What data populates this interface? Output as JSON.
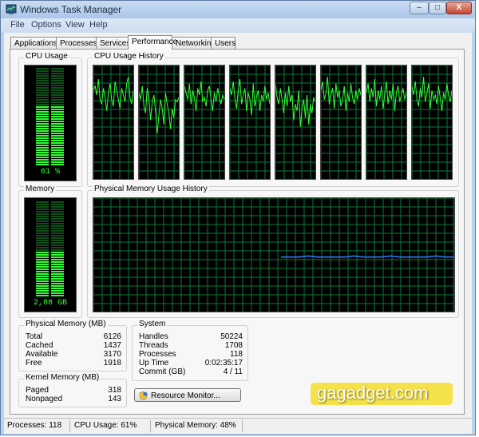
{
  "window": {
    "title": "Windows Task Manager",
    "controls": {
      "minimize": "–",
      "maximize": "□",
      "close": "X"
    }
  },
  "menu": [
    "File",
    "Options",
    "View",
    "Help"
  ],
  "tabs": [
    "Applications",
    "Processes",
    "Services",
    "Performance",
    "Networking",
    "Users"
  ],
  "active_tab": "Performance",
  "cpu": {
    "usage_label": "CPU Usage",
    "usage_text": "61 %",
    "usage_percent": 61,
    "history_label": "CPU Usage History",
    "core_count": 8,
    "core_histories": [
      [
        78,
        82,
        74,
        88,
        70,
        66,
        80,
        72,
        60,
        76,
        84,
        70,
        64,
        86,
        78,
        70,
        62,
        80,
        74,
        68,
        84,
        90,
        72,
        66,
        78
      ],
      [
        76,
        70,
        82,
        64,
        58,
        80,
        72,
        52,
        68,
        74,
        60,
        40,
        56,
        70,
        62,
        48,
        76,
        66,
        58,
        44,
        62,
        54,
        70,
        68,
        72
      ],
      [
        82,
        76,
        70,
        84,
        66,
        78,
        72,
        60,
        80,
        74,
        86,
        68,
        72,
        64,
        78,
        82,
        70,
        60,
        76,
        68,
        80,
        72,
        66,
        74,
        70
      ],
      [
        80,
        74,
        86,
        70,
        62,
        78,
        88,
        66,
        74,
        80,
        60,
        76,
        70,
        56,
        84,
        64,
        72,
        78,
        60,
        74,
        68,
        82,
        70,
        76,
        66
      ],
      [
        84,
        72,
        66,
        80,
        70,
        58,
        76,
        64,
        82,
        68,
        74,
        52,
        66,
        60,
        78,
        46,
        62,
        70,
        54,
        74,
        48,
        66,
        58,
        72,
        68
      ],
      [
        78,
        86,
        70,
        76,
        90,
        66,
        74,
        80,
        62,
        84,
        72,
        78,
        64,
        70,
        82,
        60,
        76,
        68,
        84,
        72,
        66,
        78,
        70,
        80,
        74
      ],
      [
        76,
        84,
        68,
        80,
        72,
        88,
        64,
        78,
        70,
        82,
        62,
        74,
        86,
        66,
        78,
        70,
        84,
        60,
        76,
        82,
        68,
        74,
        80,
        70,
        76
      ],
      [
        82,
        74,
        86,
        70,
        64,
        80,
        72,
        90,
        68,
        76,
        84,
        62,
        78,
        70,
        74,
        66,
        82,
        72,
        60,
        76,
        70,
        84,
        74,
        68,
        78
      ]
    ]
  },
  "memory": {
    "label": "Memory",
    "usage_text": "2,88 GB",
    "usage_percent": 48,
    "history_label": "Physical Memory Usage History",
    "history": [
      48,
      48,
      48,
      49,
      48,
      48,
      48,
      48,
      49,
      48,
      48,
      48,
      49,
      48,
      48,
      48,
      48,
      49,
      48,
      48
    ]
  },
  "physical_memory": {
    "label": "Physical Memory (MB)",
    "rows": [
      {
        "name": "Total",
        "value": "6126"
      },
      {
        "name": "Cached",
        "value": "1437"
      },
      {
        "name": "Available",
        "value": "3170"
      },
      {
        "name": "Free",
        "value": "1918"
      }
    ]
  },
  "kernel_memory": {
    "label": "Kernel Memory (MB)",
    "rows": [
      {
        "name": "Paged",
        "value": "318"
      },
      {
        "name": "Nonpaged",
        "value": "143"
      }
    ]
  },
  "system": {
    "label": "System",
    "rows": [
      {
        "name": "Handles",
        "value": "50224"
      },
      {
        "name": "Threads",
        "value": "1708"
      },
      {
        "name": "Processes",
        "value": "118"
      },
      {
        "name": "Up Time",
        "value": "0:02:35:17"
      },
      {
        "name": "Commit (GB)",
        "value": "4 / 11"
      }
    ]
  },
  "resource_monitor_button": "Resource Monitor...",
  "status": {
    "processes": "Processes: 118",
    "cpu_usage": "CPU Usage: 61%",
    "physical_memory": "Physical Memory: 48%"
  },
  "watermark": "gagadget.com",
  "colors": {
    "graph_line": "#33ff33",
    "grid": "#0b7a3a",
    "memory_line": "#2f7bff",
    "meter_on": "#33ff33",
    "meter_off": "#0f4f1a"
  }
}
